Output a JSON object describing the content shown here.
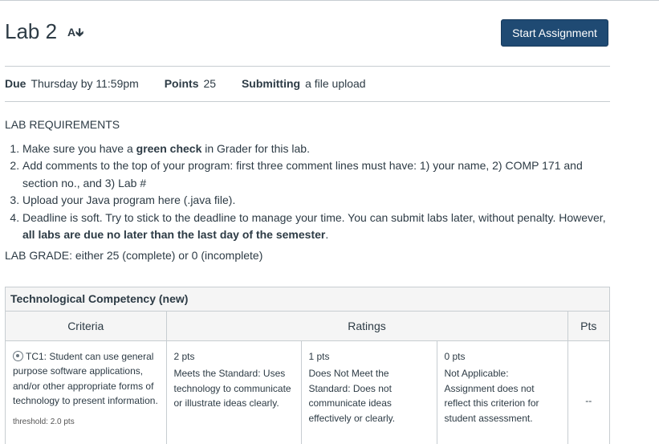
{
  "assignment": {
    "title": "Lab 2",
    "title_icon": "immersive-reader-icon",
    "start_button": "Start Assignment"
  },
  "details": {
    "due_label": "Due",
    "due_value": "Thursday by 11:59pm",
    "points_label": "Points",
    "points_value": "25",
    "submitting_label": "Submitting",
    "submitting_value": "a file upload"
  },
  "requirements": {
    "heading": "LAB REQUIREMENTS",
    "items": [
      {
        "pre": "Make sure you have a ",
        "bold": "green check",
        "post": " in Grader for this lab."
      },
      {
        "pre": "Add comments to the top of your program: first three comment lines must have: 1) your name, 2) COMP 171 and section no., and 3) Lab #",
        "bold": "",
        "post": ""
      },
      {
        "pre": "Upload your Java program here (.java file).",
        "bold": "",
        "post": ""
      },
      {
        "pre": "Deadline is soft. Try to stick to the deadline to manage your time. You can submit labs later, without penalty. However, ",
        "bold": "all labs are due no later than the last day of the semester",
        "post": "."
      }
    ],
    "grade_text": "LAB GRADE: either 25 (complete) or 0 (incomplete)"
  },
  "rubric": {
    "title": "Technological Competency (new)",
    "headers": {
      "criteria": "Criteria",
      "ratings": "Ratings",
      "pts": "Pts"
    },
    "criterion": {
      "text": "TC1: Student can use general purpose software applications, and/or other appropriate forms of technology to present information.",
      "threshold": "threshold: 2.0 pts",
      "icon": "outcome-target-icon"
    },
    "ratings": [
      {
        "points": "2 pts",
        "description": "Meets the Standard: Uses technology to communicate or illustrate ideas clearly."
      },
      {
        "points": "1 pts",
        "description": "Does Not Meet the Standard: Does not communicate ideas effectively or clearly."
      },
      {
        "points": "0 pts",
        "description": "Not Applicable: Assignment does not reflect this criterion for student assessment."
      }
    ],
    "pts_value": "--"
  }
}
